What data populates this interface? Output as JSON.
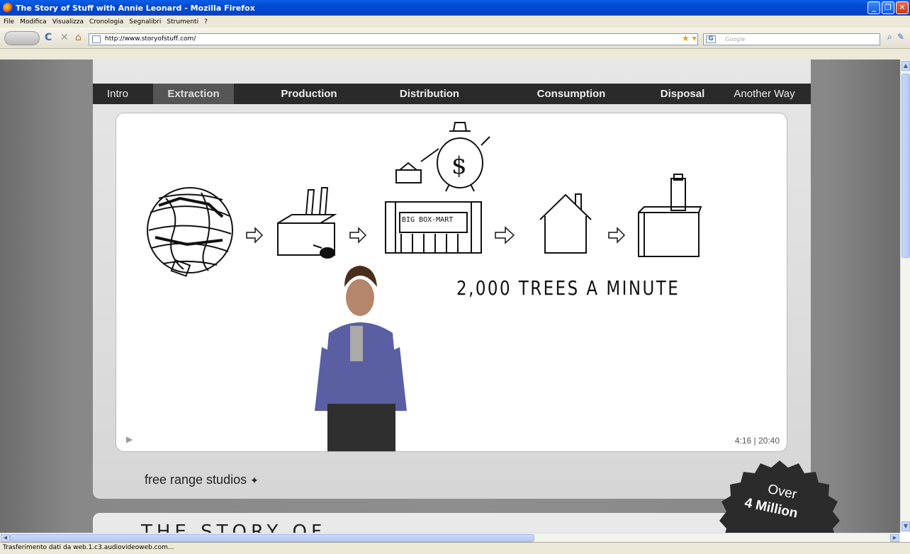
{
  "window": {
    "title": "The Story of Stuff with Annie Leonard - Mozilla Firefox"
  },
  "menu": [
    "File",
    "Modifica",
    "Visualizza",
    "Cronologia",
    "Segnalibri",
    "Strumenti",
    "?"
  ],
  "toolbar": {
    "url": "http://www.storyofstuff.com/",
    "search_placeholder": "Google"
  },
  "nav": {
    "tabs": [
      {
        "label": "Intro"
      },
      {
        "label": "Extraction"
      },
      {
        "label": "Production"
      },
      {
        "label": "Distribution"
      },
      {
        "label": "Consumption"
      },
      {
        "label": "Disposal"
      },
      {
        "label": "Another Way"
      }
    ],
    "active": "Extraction"
  },
  "video": {
    "headline": "2,000 TREES A MINUTE",
    "sign": "BIG BOX-MART",
    "time": "4:16 | 20:40",
    "play_symbol": "▶"
  },
  "credit": "free range studios",
  "next_section_partial": "THE STORY OF",
  "badge": {
    "line1": "Over",
    "line2": "4 Million"
  },
  "status": "Trasferimento dati da web.1.c3.audiovideoweb.com...",
  "colors": {
    "titlebar": "#0049d1",
    "nav_bg": "#2a2a2a",
    "nav_active": "#555555",
    "page_bg": "#888888",
    "badge": "#2b2b2b"
  }
}
